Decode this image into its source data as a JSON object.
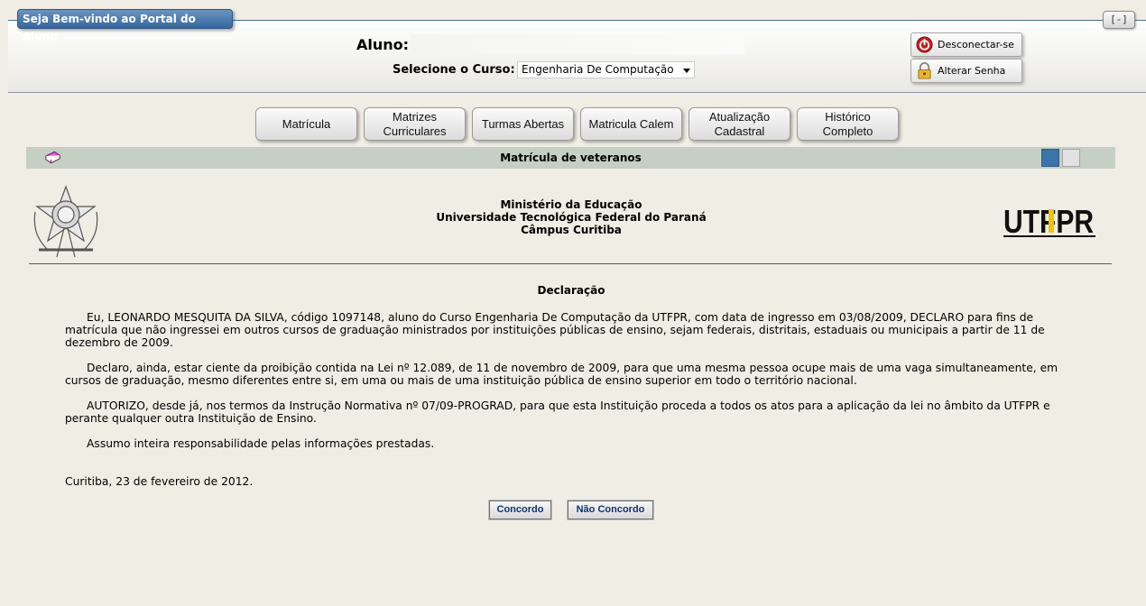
{
  "header": {
    "welcome": "Seja Bem-vindo ao Portal do Aluno",
    "collapse": "[-]",
    "aluno_label": "Aluno:",
    "aluno_value": "",
    "curso_label": "Selecione o Curso:",
    "curso_selected": "Engenharia De Computação",
    "disconnect": "Desconectar-se",
    "change_password": "Alterar Senha"
  },
  "menu": [
    {
      "line1": "Matrícula",
      "line2": ""
    },
    {
      "line1": "Matrizes",
      "line2": "Curriculares"
    },
    {
      "line1": "Turmas Abertas",
      "line2": ""
    },
    {
      "line1": "Matricula Calem",
      "line2": ""
    },
    {
      "line1": "Atualização",
      "line2": "Cadastral"
    },
    {
      "line1": "Histórico",
      "line2": "Completo"
    }
  ],
  "section": {
    "title": "Matrícula de veteranos"
  },
  "institution": {
    "line1": "Ministério da Educação",
    "line2": "Universidade Tecnológica Federal do Paraná",
    "line3": "Câmpus Curitiba",
    "logo_text": "UTFPR"
  },
  "declaration": {
    "title": "Declaração",
    "p1": "Eu, LEONARDO MESQUITA DA SILVA, código 1097148, aluno do Curso Engenharia De Computação da UTFPR, com data de ingresso em 03/08/2009, DECLARO para fins de matrícula que não ingressei em outros cursos de graduação ministrados por instituições públicas de ensino, sejam federais, distritais, estaduais ou municipais a partir de 11 de dezembro de 2009.",
    "p2": "Declaro, ainda, estar ciente da proibição contida na Lei nº 12.089, de 11 de novembro de 2009, para que uma mesma pessoa ocupe mais de uma vaga simultaneamente, em cursos de graduação, mesmo diferentes entre si, em uma ou mais de uma instituição pública de ensino superior em todo o território nacional.",
    "p3": "AUTORIZO, desde já, nos termos da Instrução Normativa nº 07/09-PROGRAD, para que esta Instituição proceda a todos os atos para a aplicação da lei no âmbito da UTFPR e perante qualquer outra Instituição de Ensino.",
    "p4": "Assumo inteira responsabilidade pelas informações prestadas.",
    "city_date": "Curitiba, 23 de fevereiro de 2012.",
    "agree": "Concordo",
    "disagree": "Não Concordo"
  },
  "colors": {
    "accent": "#3b74a8",
    "section_bar": "#c5cfc4",
    "background": "#f0ede4"
  }
}
